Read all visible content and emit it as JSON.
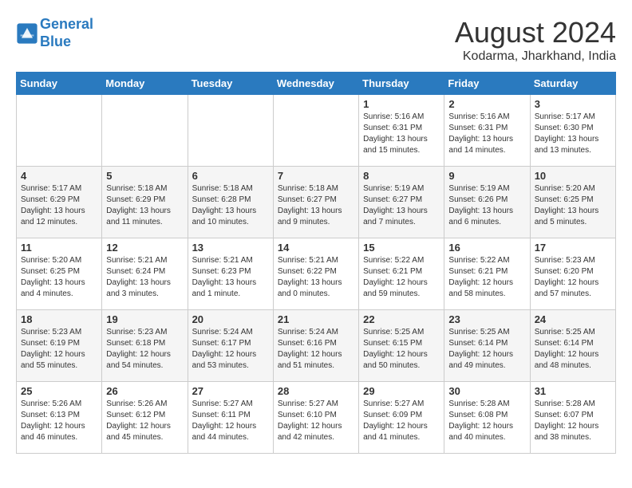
{
  "header": {
    "logo_line1": "General",
    "logo_line2": "Blue",
    "month_title": "August 2024",
    "subtitle": "Kodarma, Jharkhand, India"
  },
  "days_of_week": [
    "Sunday",
    "Monday",
    "Tuesday",
    "Wednesday",
    "Thursday",
    "Friday",
    "Saturday"
  ],
  "weeks": [
    [
      {
        "day": "",
        "info": ""
      },
      {
        "day": "",
        "info": ""
      },
      {
        "day": "",
        "info": ""
      },
      {
        "day": "",
        "info": ""
      },
      {
        "day": "1",
        "info": "Sunrise: 5:16 AM\nSunset: 6:31 PM\nDaylight: 13 hours\nand 15 minutes."
      },
      {
        "day": "2",
        "info": "Sunrise: 5:16 AM\nSunset: 6:31 PM\nDaylight: 13 hours\nand 14 minutes."
      },
      {
        "day": "3",
        "info": "Sunrise: 5:17 AM\nSunset: 6:30 PM\nDaylight: 13 hours\nand 13 minutes."
      }
    ],
    [
      {
        "day": "4",
        "info": "Sunrise: 5:17 AM\nSunset: 6:29 PM\nDaylight: 13 hours\nand 12 minutes."
      },
      {
        "day": "5",
        "info": "Sunrise: 5:18 AM\nSunset: 6:29 PM\nDaylight: 13 hours\nand 11 minutes."
      },
      {
        "day": "6",
        "info": "Sunrise: 5:18 AM\nSunset: 6:28 PM\nDaylight: 13 hours\nand 10 minutes."
      },
      {
        "day": "7",
        "info": "Sunrise: 5:18 AM\nSunset: 6:27 PM\nDaylight: 13 hours\nand 9 minutes."
      },
      {
        "day": "8",
        "info": "Sunrise: 5:19 AM\nSunset: 6:27 PM\nDaylight: 13 hours\nand 7 minutes."
      },
      {
        "day": "9",
        "info": "Sunrise: 5:19 AM\nSunset: 6:26 PM\nDaylight: 13 hours\nand 6 minutes."
      },
      {
        "day": "10",
        "info": "Sunrise: 5:20 AM\nSunset: 6:25 PM\nDaylight: 13 hours\nand 5 minutes."
      }
    ],
    [
      {
        "day": "11",
        "info": "Sunrise: 5:20 AM\nSunset: 6:25 PM\nDaylight: 13 hours\nand 4 minutes."
      },
      {
        "day": "12",
        "info": "Sunrise: 5:21 AM\nSunset: 6:24 PM\nDaylight: 13 hours\nand 3 minutes."
      },
      {
        "day": "13",
        "info": "Sunrise: 5:21 AM\nSunset: 6:23 PM\nDaylight: 13 hours\nand 1 minute."
      },
      {
        "day": "14",
        "info": "Sunrise: 5:21 AM\nSunset: 6:22 PM\nDaylight: 13 hours\nand 0 minutes."
      },
      {
        "day": "15",
        "info": "Sunrise: 5:22 AM\nSunset: 6:21 PM\nDaylight: 12 hours\nand 59 minutes."
      },
      {
        "day": "16",
        "info": "Sunrise: 5:22 AM\nSunset: 6:21 PM\nDaylight: 12 hours\nand 58 minutes."
      },
      {
        "day": "17",
        "info": "Sunrise: 5:23 AM\nSunset: 6:20 PM\nDaylight: 12 hours\nand 57 minutes."
      }
    ],
    [
      {
        "day": "18",
        "info": "Sunrise: 5:23 AM\nSunset: 6:19 PM\nDaylight: 12 hours\nand 55 minutes."
      },
      {
        "day": "19",
        "info": "Sunrise: 5:23 AM\nSunset: 6:18 PM\nDaylight: 12 hours\nand 54 minutes."
      },
      {
        "day": "20",
        "info": "Sunrise: 5:24 AM\nSunset: 6:17 PM\nDaylight: 12 hours\nand 53 minutes."
      },
      {
        "day": "21",
        "info": "Sunrise: 5:24 AM\nSunset: 6:16 PM\nDaylight: 12 hours\nand 51 minutes."
      },
      {
        "day": "22",
        "info": "Sunrise: 5:25 AM\nSunset: 6:15 PM\nDaylight: 12 hours\nand 50 minutes."
      },
      {
        "day": "23",
        "info": "Sunrise: 5:25 AM\nSunset: 6:14 PM\nDaylight: 12 hours\nand 49 minutes."
      },
      {
        "day": "24",
        "info": "Sunrise: 5:25 AM\nSunset: 6:14 PM\nDaylight: 12 hours\nand 48 minutes."
      }
    ],
    [
      {
        "day": "25",
        "info": "Sunrise: 5:26 AM\nSunset: 6:13 PM\nDaylight: 12 hours\nand 46 minutes."
      },
      {
        "day": "26",
        "info": "Sunrise: 5:26 AM\nSunset: 6:12 PM\nDaylight: 12 hours\nand 45 minutes."
      },
      {
        "day": "27",
        "info": "Sunrise: 5:27 AM\nSunset: 6:11 PM\nDaylight: 12 hours\nand 44 minutes."
      },
      {
        "day": "28",
        "info": "Sunrise: 5:27 AM\nSunset: 6:10 PM\nDaylight: 12 hours\nand 42 minutes."
      },
      {
        "day": "29",
        "info": "Sunrise: 5:27 AM\nSunset: 6:09 PM\nDaylight: 12 hours\nand 41 minutes."
      },
      {
        "day": "30",
        "info": "Sunrise: 5:28 AM\nSunset: 6:08 PM\nDaylight: 12 hours\nand 40 minutes."
      },
      {
        "day": "31",
        "info": "Sunrise: 5:28 AM\nSunset: 6:07 PM\nDaylight: 12 hours\nand 38 minutes."
      }
    ]
  ]
}
